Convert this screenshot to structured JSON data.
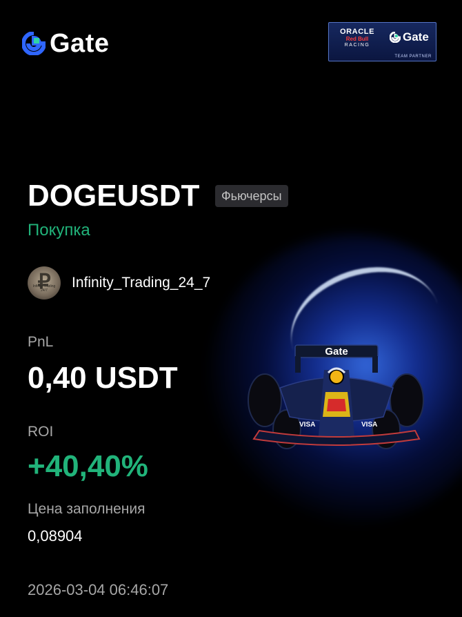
{
  "brand": {
    "name": "Gate",
    "icon": "gate-logo-icon",
    "accent_color": "#2f66ff"
  },
  "partner_badge": {
    "line1": "ORACLE",
    "line2": "Red Bull",
    "line3": "RACING",
    "brand": "Gate",
    "subtitle": "TEAM PARTNER"
  },
  "trade": {
    "symbol": "DOGEUSDT",
    "market": "Фьючерсы",
    "direction": "Покупка",
    "trader_name": "Infinity_Trading_24_7",
    "avatar_lettering": "Infinity Trading 24/7",
    "pnl_label": "PnL",
    "pnl_value": "0,40 USDT",
    "roi_label": "ROI",
    "roi_value": "+40,40%",
    "fill_price_label": "Цена заполнения",
    "fill_price_value": "0,08904",
    "timestamp": "2026-03-04 06:46:07"
  },
  "car_livery": {
    "rear_wing_text": "Gate",
    "sidepod_text": "VISA"
  },
  "colors": {
    "background": "#000000",
    "positive": "#21b37a",
    "muted": "#a7a7a7",
    "badge_bg": "#2b2b2f",
    "glow_blue": "#2f5dff"
  }
}
